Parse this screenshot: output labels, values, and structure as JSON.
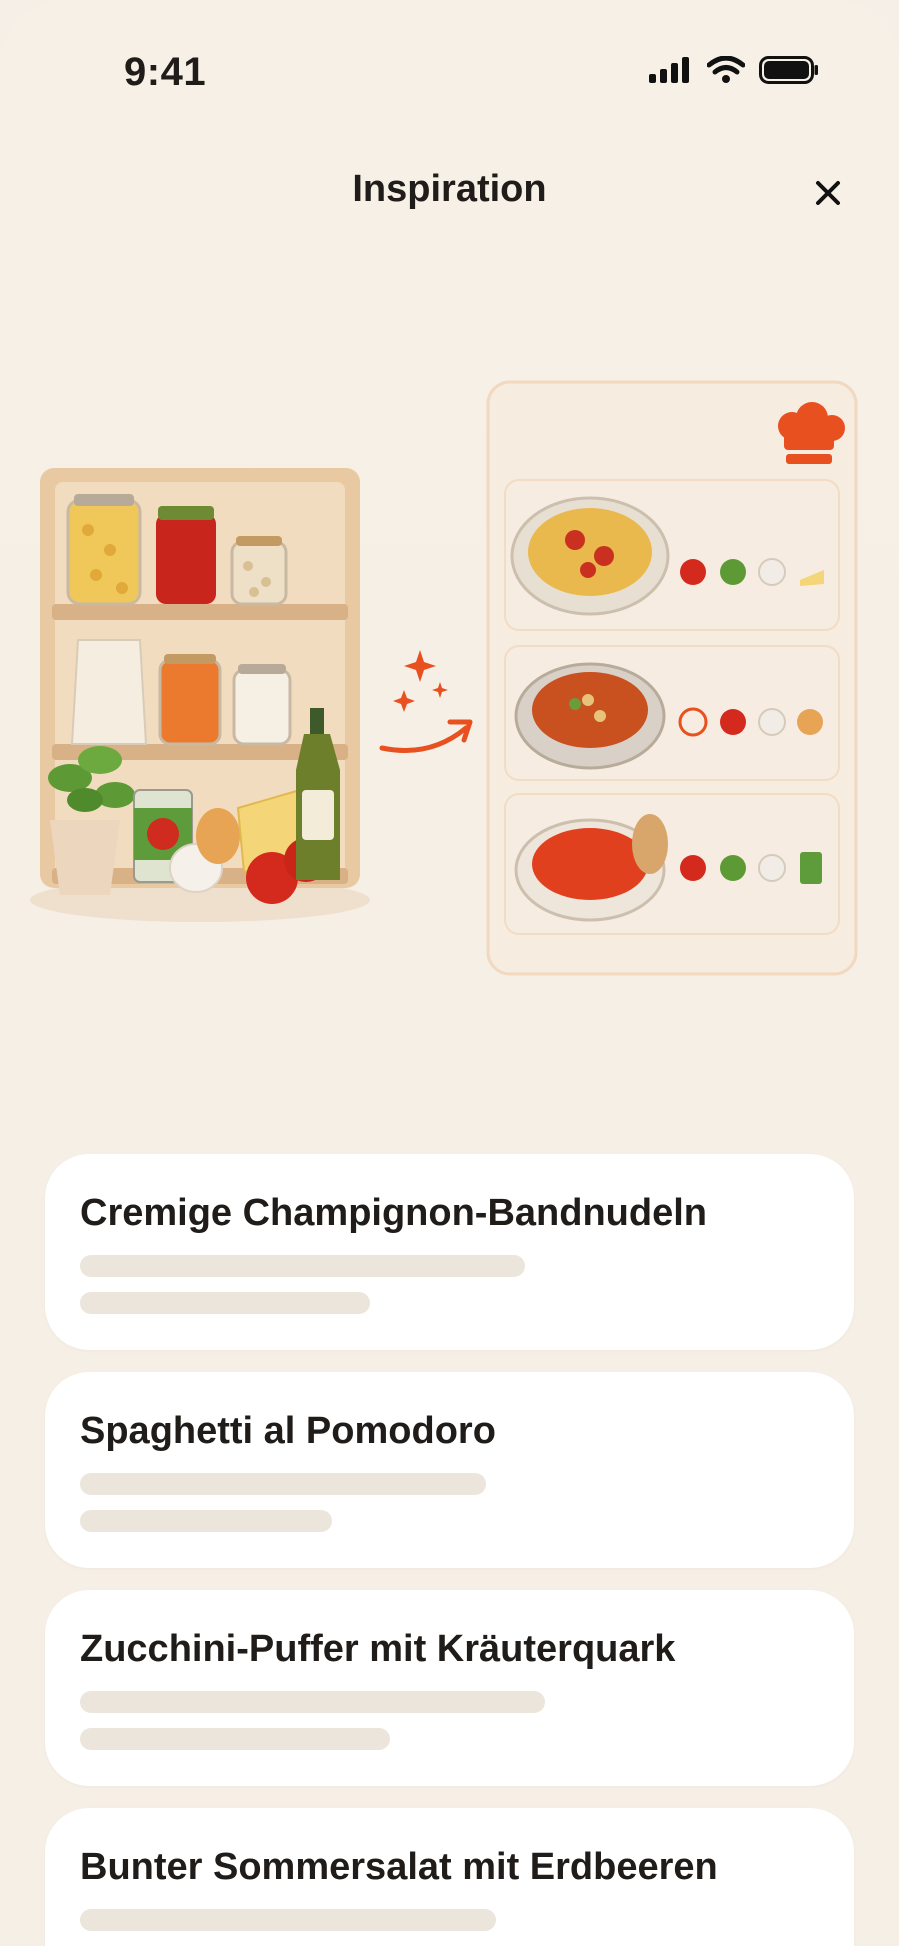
{
  "status_bar": {
    "time": "9:41",
    "icons": [
      "signal-icon",
      "wifi-icon",
      "battery-icon"
    ]
  },
  "header": {
    "title": "Inspiration",
    "close_icon": "close-icon"
  },
  "illustration": {
    "pantry_items": [
      "pasta-jar",
      "tomato-sauce-jar",
      "chickpea-jar",
      "flour-bag",
      "lentil-jar",
      "rice-jar",
      "basil-plant",
      "tomato-can",
      "garlic",
      "onion",
      "cheese",
      "tomatoes",
      "olive-oil-bottle"
    ],
    "chef_hat_icon": "chef-hat-icon",
    "sparkle_icon": "sparkle-icon",
    "arrow_icon": "curved-arrow-icon",
    "recipe_previews": [
      {
        "dish": "spaghetti-bowl",
        "ingredients": [
          "tomato",
          "basil",
          "garlic",
          "cheese"
        ]
      },
      {
        "dish": "chickpea-stew-pot",
        "ingredients": [
          "chili",
          "tomato",
          "garlic",
          "onion"
        ]
      },
      {
        "dish": "tomato-soup-bowl",
        "ingredients": [
          "tomato",
          "basil",
          "garlic",
          "tomato-can"
        ]
      }
    ]
  },
  "recipes": [
    {
      "title": "Cremige Champignon-Bandnudeln",
      "line1": 0.67,
      "line2": 0.44
    },
    {
      "title": "Spaghetti al Pomodoro",
      "line1": 0.61,
      "line2": 0.38
    },
    {
      "title": "Zucchini-Puffer mit Kräuterquark",
      "line1": 0.7,
      "line2": 0.47
    },
    {
      "title": "Bunter Sommersalat mit Erdbeeren",
      "line1": 0.63,
      "line2": 0.4
    }
  ],
  "colors": {
    "background": "#f6efe6",
    "card": "#ffffff",
    "skeleton": "#ebe5dc",
    "accent": "#e8501f",
    "panel_border": "#f1d8bf"
  }
}
